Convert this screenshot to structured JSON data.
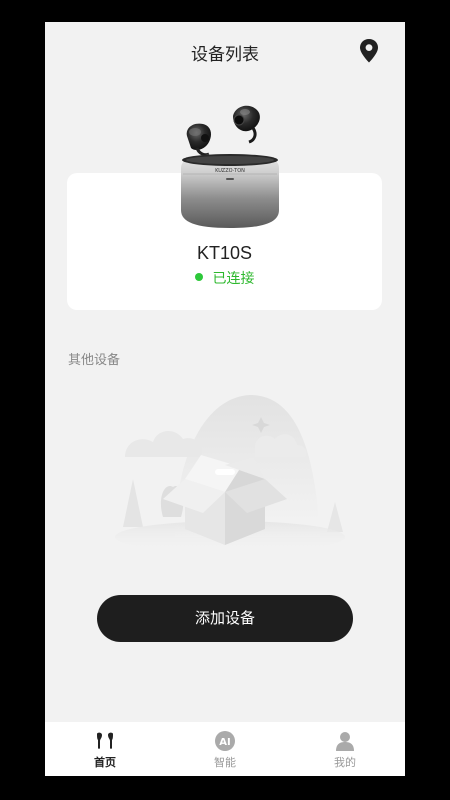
{
  "header": {
    "title": "设备列表",
    "location_icon": "location-pin-icon"
  },
  "device": {
    "name": "KT10S",
    "status": "已连接",
    "status_color": "#2dc83a",
    "case_brand_text": "KUZZO·TON"
  },
  "other_devices": {
    "label": "其他设备"
  },
  "actions": {
    "add_device_label": "添加设备"
  },
  "tabbar": {
    "items": [
      {
        "label": "首页",
        "icon": "earbuds-icon",
        "active": true
      },
      {
        "label": "智能",
        "icon": "ai-icon",
        "active": false
      },
      {
        "label": "我的",
        "icon": "person-icon",
        "active": false
      }
    ]
  },
  "colors": {
    "background": "#f2f2f2",
    "card": "#ffffff",
    "primary_button": "#1e1e1e",
    "connected_green": "#2dc83a"
  }
}
